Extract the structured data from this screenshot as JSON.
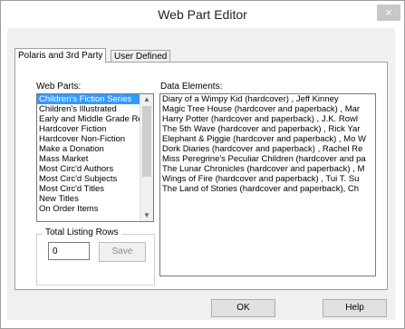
{
  "window": {
    "title": "Web Part Editor",
    "close_glyph": "×"
  },
  "tabs": [
    {
      "label": "Polaris and 3rd Party"
    },
    {
      "label": "User Defined"
    }
  ],
  "web_parts": {
    "label": "Web Parts:",
    "items": [
      "Children's Fiction Series",
      "Children's Illustrated",
      "Early and Middle Grade Re",
      "Hardcover Fiction",
      "Hardcover Non-Fiction",
      "Make a Donation",
      "Mass Market",
      "Most Circ'd Authors",
      "Most Circ'd Subjects",
      "Most Circ'd Titles",
      "New Titles",
      "On Order Items"
    ],
    "selected_index": 0
  },
  "data_elements": {
    "label": "Data Elements:",
    "items": [
      "Diary of a Wimpy Kid (hardcover) , Jeff Kinney",
      "Magic Tree House (hardcover and paperback) , Mar",
      "Harry Potter (hardcover and paperback) , J.K. Rowl",
      "The 5th Wave (hardcover and paperback) , Rick Yar",
      "Elephant & Piggie (hardcover and paperback) , Mo W",
      "Dork Diaries (hardcover and paperback) , Rachel Re",
      "Miss Peregrine's Peculiar Children (hardcover and pa",
      "The Lunar Chronicles (hardcover and paperback) , M",
      "Wings of Fire (hardcover and paperback) , Tui T. Su",
      "The Land of Stories (hardcover and paperback), Ch"
    ]
  },
  "total_listing_rows": {
    "label": "Total Listing Rows",
    "value": "0",
    "save_label": "Save"
  },
  "buttons": {
    "ok": "OK",
    "help": "Help"
  }
}
